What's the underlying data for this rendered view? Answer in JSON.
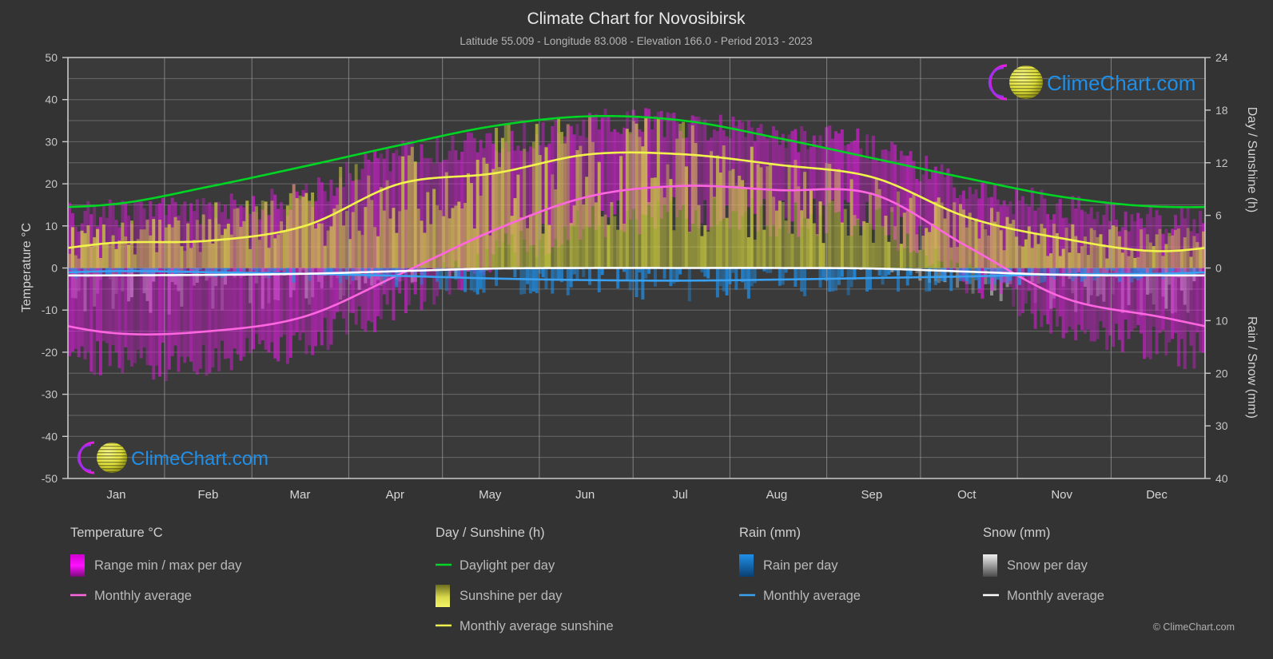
{
  "header": {
    "title": "Climate Chart for Novosibirsk",
    "subtitle": "Latitude 55.009 - Longitude 83.008 - Elevation 166.0 - Period 2013 - 2023"
  },
  "branding": {
    "logo_text": "ClimeChart.com",
    "copyright": "© ClimeChart.com"
  },
  "axes": {
    "left_label": "Temperature °C",
    "right_top_label": "Day / Sunshine (h)",
    "right_bottom_label": "Rain / Snow (mm)",
    "left_ticks": [
      "50",
      "40",
      "30",
      "20",
      "10",
      "0",
      "-10",
      "-20",
      "-30",
      "-40",
      "-50"
    ],
    "right_top_ticks": [
      "24",
      "18",
      "12",
      "6",
      "0"
    ],
    "right_bottom_ticks": [
      "0",
      "10",
      "20",
      "30",
      "40"
    ]
  },
  "legend": {
    "groups": [
      {
        "title": "Temperature °C",
        "items": [
          {
            "label": "Range min / max per day",
            "marker": "gradient-swatch",
            "color": "#ff00ff"
          },
          {
            "label": "Monthly average",
            "marker": "line",
            "color": "#ff66e0"
          }
        ]
      },
      {
        "title": "Day / Sunshine (h)",
        "items": [
          {
            "label": "Daylight per day",
            "marker": "line",
            "color": "#00d424"
          },
          {
            "label": "Sunshine per day",
            "marker": "gradient-swatch",
            "color": "#e8e84a"
          },
          {
            "label": "Monthly average sunshine",
            "marker": "line",
            "color": "#f2f24d"
          }
        ]
      },
      {
        "title": "Rain (mm)",
        "items": [
          {
            "label": "Rain per day",
            "marker": "gradient-swatch",
            "color": "#1f8fe8"
          },
          {
            "label": "Monthly average",
            "marker": "line",
            "color": "#3aa0f0"
          }
        ]
      },
      {
        "title": "Snow (mm)",
        "items": [
          {
            "label": "Snow per day",
            "marker": "gradient-swatch",
            "color": "#e6e6e6"
          },
          {
            "label": "Monthly average",
            "marker": "line",
            "color": "#ffffff"
          }
        ]
      }
    ]
  },
  "chart_data": {
    "type": "line",
    "title": "Climate Chart for Novosibirsk",
    "subtitle": "Latitude 55.009 - Longitude 83.008 - Elevation 166.0 - Period 2013 - 2023",
    "xlabel": "",
    "ylabel": "Temperature °C",
    "categories": [
      "Jan",
      "Feb",
      "Mar",
      "Apr",
      "May",
      "Jun",
      "Jul",
      "Aug",
      "Sep",
      "Oct",
      "Nov",
      "Dec"
    ],
    "ylim": [
      -50,
      50
    ],
    "y2lim_day": [
      0,
      24
    ],
    "y2lim_precip": [
      0,
      40
    ],
    "grid": true,
    "legend_position": "below",
    "series": [
      {
        "name": "Monthly average max temperature",
        "axis": "temperature",
        "unit": "°C",
        "color": "#f2f24d",
        "values": [
          6.0,
          6.5,
          10.0,
          20.0,
          22.5,
          27.0,
          27.0,
          24.5,
          21.5,
          12.0,
          7.0,
          4.0
        ]
      },
      {
        "name": "Monthly average min temperature",
        "axis": "temperature",
        "unit": "°C",
        "color": "#ff66e0",
        "values": [
          -15.5,
          -15.0,
          -11.5,
          -1.5,
          9.0,
          17.0,
          19.5,
          18.5,
          17.5,
          5.0,
          -7.0,
          -11.5
        ]
      },
      {
        "name": "Daylight per day",
        "axis": "day_sunshine",
        "unit": "h",
        "color": "#00d424",
        "values": [
          7.3,
          9.3,
          11.6,
          14.0,
          16.2,
          17.3,
          16.8,
          14.8,
          12.5,
          10.2,
          8.1,
          7.0
        ]
      },
      {
        "name": "Rain monthly average",
        "axis": "rain",
        "unit": "mm",
        "color": "#3aa0f0",
        "values": [
          0.6,
          0.8,
          1.1,
          1.5,
          2.0,
          2.3,
          2.4,
          2.2,
          1.9,
          1.6,
          1.2,
          1.1
        ]
      },
      {
        "name": "Snow monthly average",
        "axis": "snow",
        "unit": "mm",
        "color": "#ffffff",
        "values": [
          1.4,
          1.3,
          1.1,
          0.6,
          0.1,
          0.0,
          0.0,
          0.0,
          0.1,
          0.7,
          1.3,
          1.4
        ]
      }
    ],
    "daily_ranges_note": "Vertical bars show daily min/max temperature range (magenta), daily sunshine hours (yellow), daily rain (blue) and daily snow (grey)."
  }
}
